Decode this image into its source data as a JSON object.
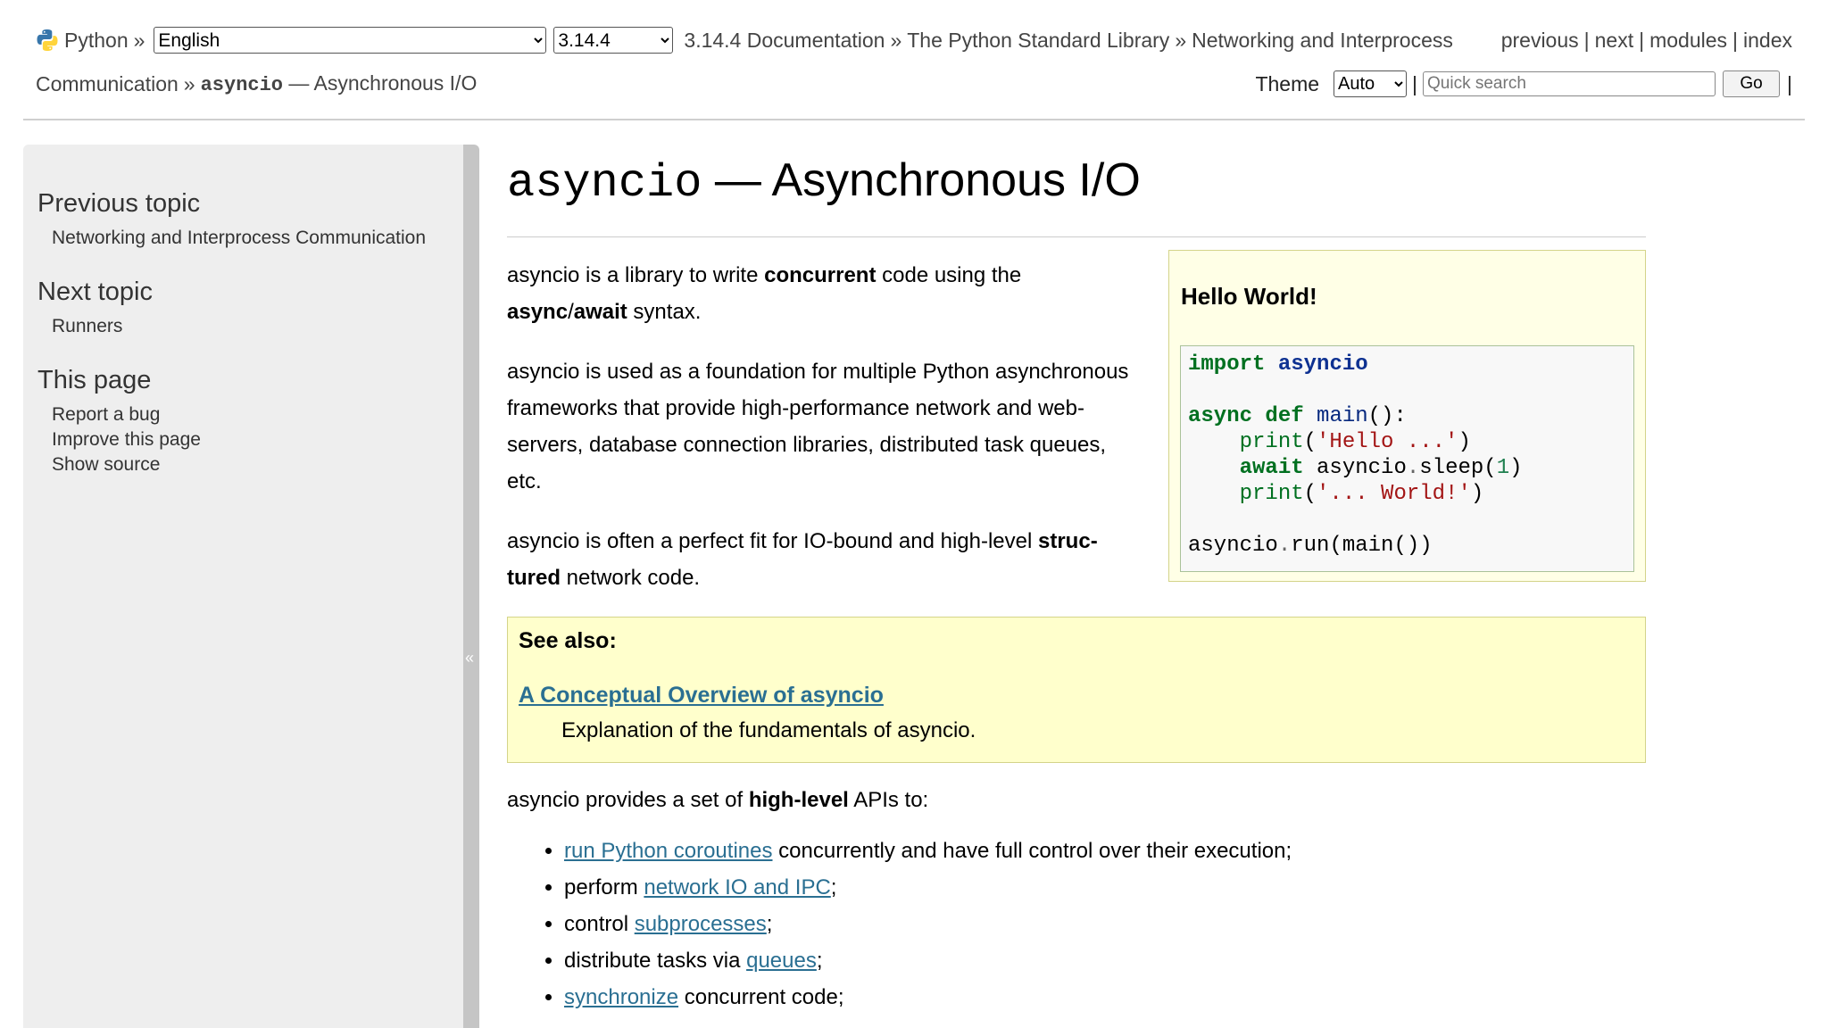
{
  "header": {
    "python_label": "Python",
    "sep": "»",
    "language_selected": "English",
    "version_selected": "3.14.4",
    "breadcrumb_doc": "3.14.4 Documentation",
    "breadcrumb_lib": "The Python Standard Library",
    "breadcrumb_section_part1": "Networking and Interprocess",
    "breadcrumb_section_part2": "Communication",
    "breadcrumb_module_code": "asyncio",
    "breadcrumb_module_rest": "— Asynchronous I/O",
    "nav": {
      "previous": "previous",
      "next": "next",
      "modules": "modules",
      "index": "index",
      "bar": "|"
    },
    "theme_label": "Theme",
    "theme_selected": "Auto",
    "search_placeholder": "Quick search",
    "go_label": "Go"
  },
  "sidebar": {
    "previous_heading": "Previous topic",
    "previous_link": "Networking and Interprocess Communication",
    "next_heading": "Next topic",
    "next_link": "Runners",
    "this_page_heading": "This page",
    "links": [
      "Report a bug",
      "Improve this page",
      "Show source"
    ],
    "collapse_glyph": "«"
  },
  "main": {
    "title_code": "asyncio",
    "title_rest": " — Asynchronous I/O",
    "p1": {
      "a": "asyncio is a library to write ",
      "b": "concurrent",
      "c": " code using the ",
      "d": "async",
      "e": "/",
      "f": "await",
      "g": " syntax."
    },
    "p2": "asyncio is used as a foundation for multiple Python asynchro­nous frameworks that provide high-performance network and web-servers, database connection libraries, distributed task queues, etc.",
    "p3": {
      "a": "asyncio is often a perfect fit for IO-bound and high-level ",
      "b": "struc­tured",
      "c": " network code."
    },
    "hello_title": "Hello World!",
    "see_also": {
      "title": "See also:",
      "link": "A Conceptual Overview of asyncio",
      "desc": "Explanation of the fundamentals of asyncio."
    },
    "api_intro": {
      "a": "asyncio provides a set of ",
      "b": "high-level",
      "c": " APIs to:"
    },
    "api_items": [
      {
        "link": "run Python coroutines",
        "pre": "",
        "post": " concurrently and have full control over their execution;"
      },
      {
        "link": "network IO and IPC",
        "pre": "perform ",
        "post": ";"
      },
      {
        "link": "subprocesses",
        "pre": "control ",
        "post": ";"
      },
      {
        "link": "queues",
        "pre": "distribute tasks via ",
        "post": ";"
      },
      {
        "link": "synchronize",
        "pre": "",
        "post": " concurrent code;"
      }
    ]
  },
  "code": {
    "import": "import",
    "asyncio": "asyncio",
    "async": "async",
    "def": "def",
    "main": "main",
    "parens_colon": "():",
    "print": "print",
    "hello_str": "'Hello ...'",
    "await": "await",
    "asyncio_plain": "asyncio",
    "dot": ".",
    "sleep": "sleep(",
    "one": "1",
    "close": ")",
    "open": "(",
    "world_str": "'... World!'",
    "run_line_a": "asyncio",
    "run_line_b": "run(main())"
  }
}
